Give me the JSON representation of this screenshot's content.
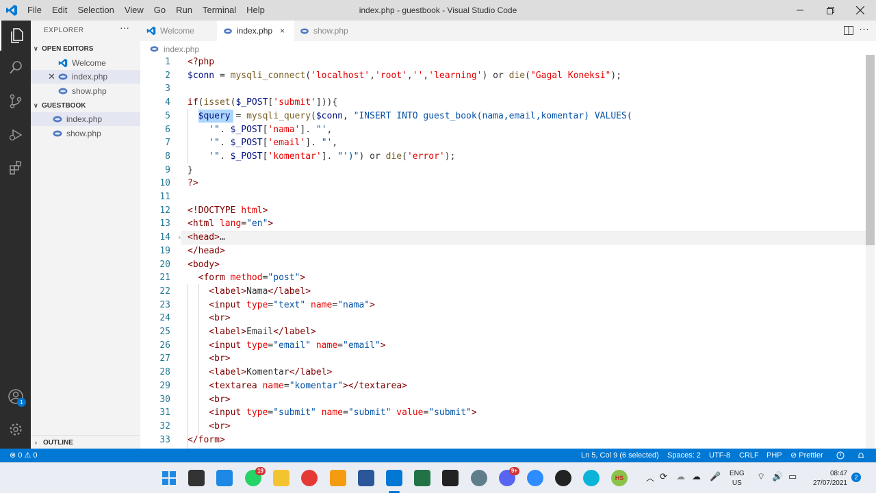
{
  "window": {
    "title": "index.php - guestbook - Visual Studio Code",
    "menu": [
      "File",
      "Edit",
      "Selection",
      "View",
      "Go",
      "Run",
      "Terminal",
      "Help"
    ]
  },
  "activity": {
    "account_badge": "1"
  },
  "sidebar": {
    "title": "EXPLORER",
    "more": "···",
    "open_editors_label": "OPEN EDITORS",
    "open_editors": [
      "Welcome",
      "index.php",
      "show.php"
    ],
    "workspace_label": "GUESTBOOK",
    "files": [
      "index.php",
      "show.php"
    ],
    "outline_label": "OUTLINE"
  },
  "tabs": {
    "items": [
      "Welcome",
      "index.php",
      "show.php"
    ],
    "close": "×",
    "more": "···"
  },
  "breadcrumb": {
    "file": "index.php"
  },
  "editor": {
    "fold_marker": "›",
    "line_numbers": [
      "1",
      "2",
      "3",
      "4",
      "5",
      "6",
      "7",
      "8",
      "9",
      "10",
      "11",
      "12",
      "13",
      "14",
      "19",
      "20",
      "21",
      "22",
      "23",
      "24",
      "25",
      "26",
      "27",
      "28",
      "29",
      "30",
      "31",
      "32",
      "33"
    ]
  },
  "status": {
    "problems": "⊗ 0 ⚠ 0",
    "position": "Ln 5, Col 9 (6 selected)",
    "spaces": "Spaces: 2",
    "encoding": "UTF-8",
    "eol": "CRLF",
    "language": "PHP",
    "prettier": "⊘ Prettier"
  },
  "taskbar": {
    "whatsapp_badge": "19",
    "discord_badge": "9+",
    "hs_label": "HS",
    "lang_top": "ENG",
    "lang_bottom": "US",
    "time": "08:47",
    "date": "27/07/2021",
    "notif_count": "2"
  }
}
